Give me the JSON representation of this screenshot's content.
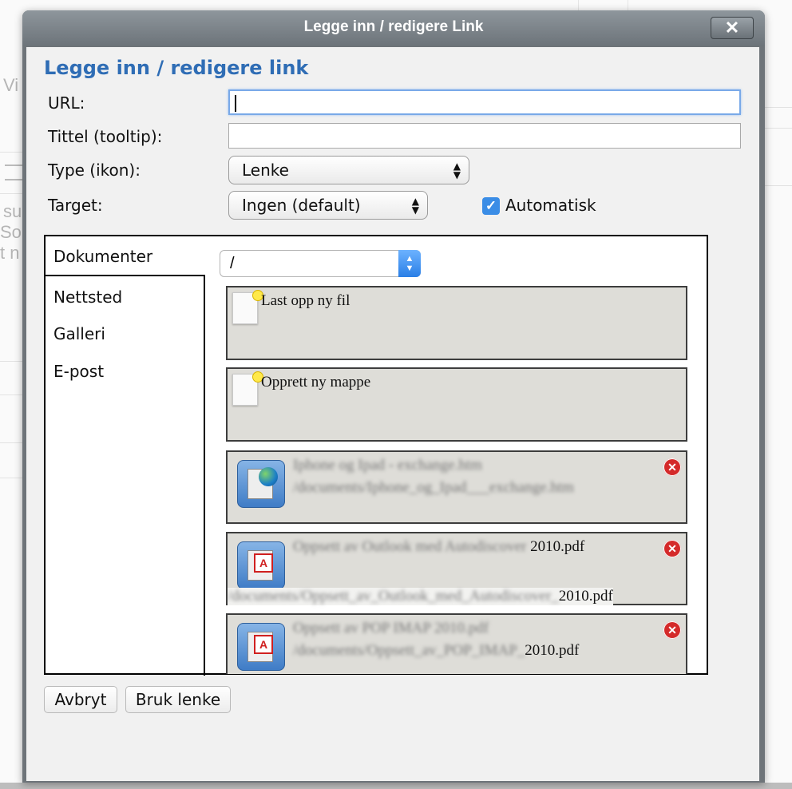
{
  "background": {
    "fragments": [
      "Vi",
      "su",
      "So",
      "t n"
    ]
  },
  "dialog": {
    "title": "Legge inn / redigere Link",
    "close_label": "✕",
    "heading": "Legge inn / redigere link",
    "fields": {
      "url_label": "URL:",
      "url_value": "",
      "title_label": "Tittel (tooltip):",
      "title_value": "",
      "type_label": "Type (ikon):",
      "type_selected": "Lenke",
      "automatic_label": "Automatisk",
      "automatic_checked": true,
      "target_label": "Target:",
      "target_selected": "Ingen (default)"
    },
    "tabs": [
      {
        "label": "Dokumenter",
        "active": true
      },
      {
        "label": "Nettsted",
        "active": false
      },
      {
        "label": "Galleri",
        "active": false
      },
      {
        "label": "E-post",
        "active": false
      }
    ],
    "path": "/",
    "files": [
      {
        "type": "upload",
        "name": "Last opp ny fil"
      },
      {
        "type": "new-folder",
        "name": "Opprett ny mappe"
      },
      {
        "type": "web",
        "name": "Iphone og Ipad - exchange.htm",
        "path": "/documents/Iphone_og_Ipad___exchange.htm"
      },
      {
        "type": "pdf",
        "name_visible": "2010.pdf",
        "name_blurred": "Oppsett av Outlook med Autodiscover ",
        "path_visible": "2010.pdf",
        "path_blurred": "/documents/Oppsett_av_Outlook_med_Autodiscover_"
      },
      {
        "type": "pdf",
        "name_blurred": "Oppsett av POP IMAP 2010.pdf",
        "path_visible": "2010.pdf",
        "path_blurred": "/documents/Oppsett_av_POP_IMAP_"
      }
    ],
    "buttons": {
      "cancel": "Avbryt",
      "apply": "Bruk lenke"
    }
  },
  "colors": {
    "heading": "#2f6db5",
    "titlebar": "#6d747a",
    "item_bg": "#deddd8",
    "checkbox": "#3b8de6",
    "delete": "#d42a2a"
  }
}
